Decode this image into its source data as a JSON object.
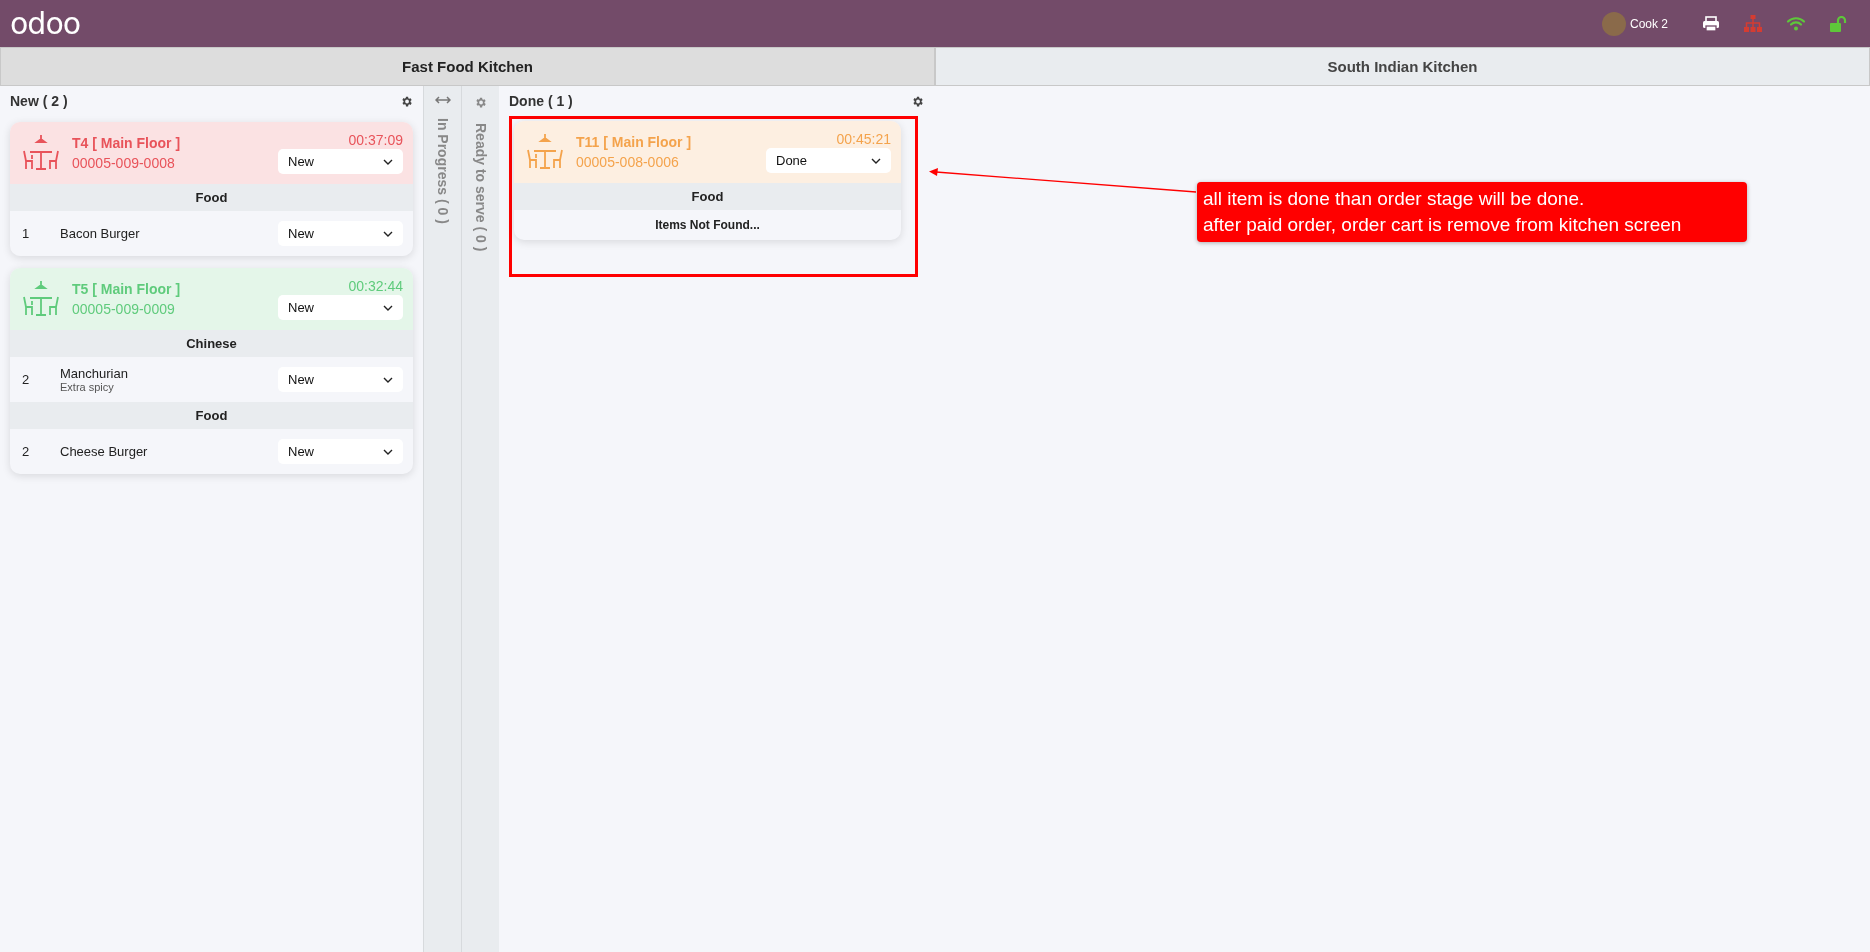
{
  "topbar": {
    "logo": "odoo",
    "user": "Cook 2"
  },
  "kitchens": [
    {
      "label": "Fast Food Kitchen",
      "selected": true
    },
    {
      "label": "South Indian Kitchen",
      "selected": false
    }
  ],
  "stages": [
    {
      "kind": "column",
      "title": "New ( 2 )",
      "orders": [
        {
          "table": "T4 [ Main Floor ]",
          "ref": "00005-009-0008",
          "time": "00:37:09",
          "status": "New",
          "color": "#e8535a",
          "highlighted": false,
          "groups": [
            {
              "name": "Food",
              "items": [
                {
                  "qty": "1",
                  "name": "Bacon Burger",
                  "status": "New"
                }
              ]
            }
          ]
        },
        {
          "table": "T5 [ Main Floor ]",
          "ref": "00005-009-0009",
          "time": "00:32:44",
          "status": "New",
          "color": "#5fcb7c",
          "highlighted": false,
          "groups": [
            {
              "name": "Chinese",
              "items": [
                {
                  "qty": "2",
                  "name": "Manchurian",
                  "note": "Extra spicy",
                  "status": "New"
                }
              ]
            },
            {
              "name": "Food",
              "items": [
                {
                  "qty": "2",
                  "name": "Cheese Burger",
                  "status": "New"
                }
              ]
            }
          ]
        }
      ]
    },
    {
      "kind": "collapsed-toggle",
      "title": "In Progress ( 0 )"
    },
    {
      "kind": "collapsed",
      "title": "Ready to serve ( 0 )"
    },
    {
      "kind": "column",
      "title": "Done ( 1 )",
      "orders": [
        {
          "table": "T11 [ Main Floor ]",
          "ref": "00005-008-0006",
          "time": "00:45:21",
          "status": "Done",
          "color": "#f4a34c",
          "highlighted": true,
          "groups": [
            {
              "name": "Food",
              "empty": "Items Not Found..."
            }
          ]
        }
      ]
    }
  ],
  "annotation": {
    "lines": [
      "all item is done than order stage will be done.",
      "after paid order, order cart is remove from kitchen screen"
    ]
  }
}
